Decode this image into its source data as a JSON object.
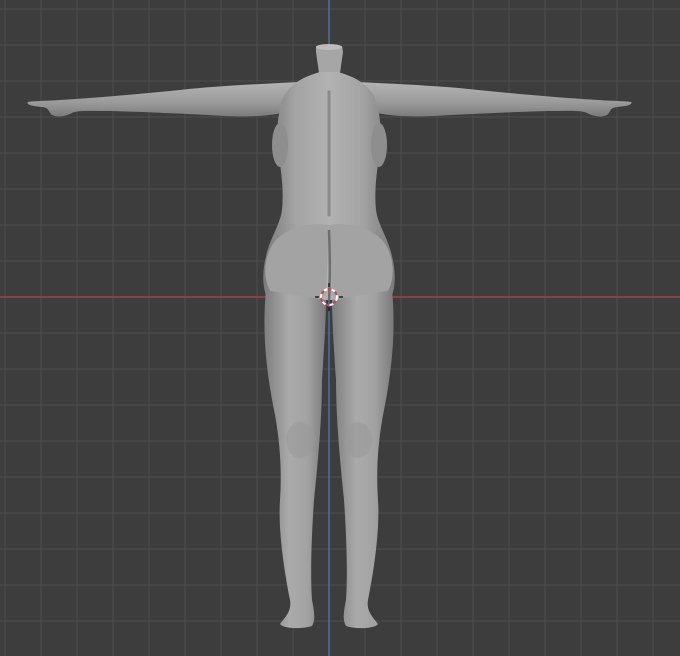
{
  "viewport": {
    "background_color": "#3d3d3d",
    "grid_minor_color": "#464646",
    "grid_major_color": "#4d4d4d",
    "axis_x_color": "#b2434b",
    "axis_z_color": "#4f7fb5",
    "mesh_color": "#9c9c9c",
    "mesh_shadow_color": "#707070",
    "mesh_highlight_color": "#c2c2c2",
    "cursor_ring_color": "#d04545",
    "cursor_ring_alt_color": "#ffffff"
  },
  "icons": {
    "cursor": "3d-cursor-icon"
  }
}
